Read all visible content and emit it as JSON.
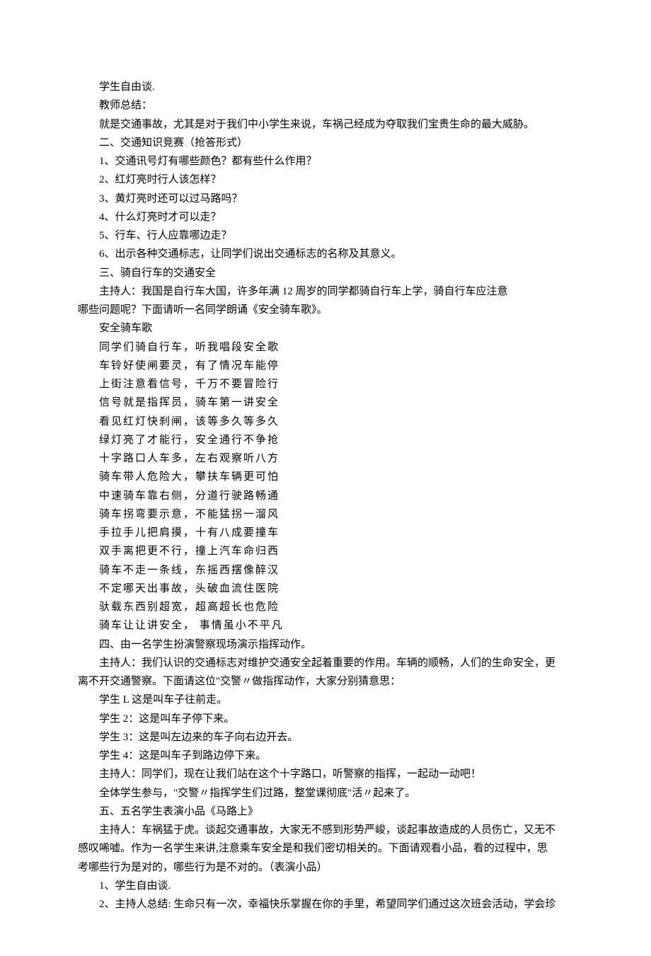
{
  "p": [
    "学生自由谈.",
    "教师总结：",
    "就是交通事故，尤其是对于我们中小学生来说，车祸己经成为夺取我们宝贵生命的最大威胁。",
    "二、交通知识竞赛（抢答形式）",
    "1、交通讯号灯有哪些颜色？都有些什么作用？",
    "2、红灯亮时行人该怎样？",
    "3、黄灯亮时还可以过马路吗？",
    "4、什么灯亮时才可以走？",
    "5、行车、行人应靠哪边走？",
    "6、出示各种交通标志，让同学们说出交通标志的名称及其意义。",
    "三、骑自行车的交通安全"
  ],
  "host1_a": "主持人：我国是自行车大国，许多年满 12 周岁的同学都骑自行车上学，骑自行车应注意",
  "host1_b": "哪些问题呢？下面请听一名同学朗诵《安全骑车歌》。",
  "poem_title": "安全骑车歌",
  "poem": [
    "同学们骑自行车，听我唱段安全歌",
    "车铃好使闸要灵，有了情况车能停",
    "上街注意看信号，千万不要冒险行",
    "信号就是指挥员，骑车第一讲安全",
    "看见红灯快刹闸，该等多久等多久",
    "绿灯亮了才能行，安全通行不争抢",
    "十字路口人车多，左右观察听八方",
    "骑车带人危险大，攀扶车辆更可怕",
    "中速骑车靠右侧，分道行驶路畅通",
    "骑车拐弯要示意，不能猛拐一溜风",
    "手拉手儿把肩摸，十有八成要撞车",
    "双手离把更不行，撞上汽车命归西",
    "骑车不走一条线，东摇西摆像醉汉",
    "不定哪天出事故，头破血流住医院",
    "驮载东西别超宽，超高超长也危险",
    "骑车让让讲安全，  事情虽小不平凡"
  ],
  "s4": "四、由一名学生扮演警察现场演示指挥动作。",
  "host2_a": "主持人：我们认识的交通标志对维护交通安全起着重要的作用。车辆的顺畅，人们的生命安全，更",
  "host2_b": "离不开交通警察。下面请这位\"交警〃做指挥动作，大家分别猜意思：",
  "stu1": "学生 L 这是叫车子往前走。",
  "stu2": "学生 2：这是叫车子停下来。",
  "stu3": "学生 3：这是叫左边来的车子向右边开去。",
  "stu4": "学生 4：这是叫车子到路边停下来。",
  "host3": "主持人：同学们，现在让我们站在这个十字路口，听警察的指挥，一起动一动吧！",
  "all": "全体学生参与，\"交警〃指挥学生们过路，整堂课彻底\"活〃起来了。",
  "s5": "五、五名学生表演小品《马路上》",
  "host4_a": "主持人：车祸猛于虎。谈起交通事故，大家无不感到形势严峻，谈起事故造成的人员伤亡，又无不",
  "host4_b": "感叹唏嘘。作为一名学生来讲,注意乘车安全是和我们密切相关的。下面请观看小品，看的过程中，思",
  "host4_c": "考哪些行为是对的，哪些行为是不对的。（表演小品）",
  "end1": "1、学生自由谈.",
  "end2": "2、主持人总结: 生命只有一次，幸福快乐掌握在你的手里，希望同学们通过这次班会活动，学会珍"
}
